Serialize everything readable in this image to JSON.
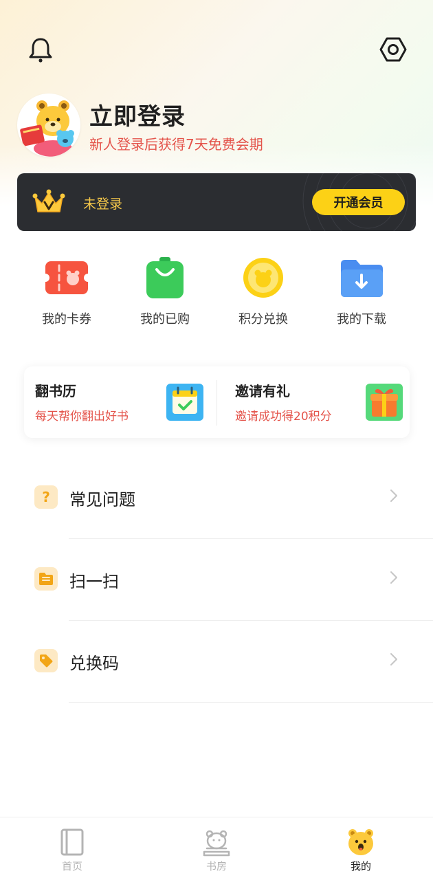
{
  "header": {
    "notification_icon": "bell-icon",
    "settings_icon": "hexagon-settings-icon"
  },
  "profile": {
    "avatar": "bear-mascot-avatar",
    "login_title": "立即登录",
    "login_subtitle": "新人登录后获得7天免费会期"
  },
  "vip": {
    "status": "未登录",
    "button_label": "开通会员",
    "accent_color": "#fcd116"
  },
  "quick_actions": [
    {
      "label": "我的卡券",
      "icon": "coupon-icon"
    },
    {
      "label": "我的已购",
      "icon": "shopping-bag-icon"
    },
    {
      "label": "积分兑换",
      "icon": "coin-icon"
    },
    {
      "label": "我的下载",
      "icon": "download-folder-icon"
    }
  ],
  "promos": [
    {
      "title": "翻书历",
      "subtitle": "每天帮你翻出好书",
      "icon": "calendar-icon"
    },
    {
      "title": "邀请有礼",
      "subtitle": "邀请成功得20积分",
      "icon": "gift-icon"
    }
  ],
  "menu": [
    {
      "label": "常见问题",
      "icon": "question-icon"
    },
    {
      "label": "扫一扫",
      "icon": "scan-icon"
    },
    {
      "label": "兑换码",
      "icon": "tag-icon"
    }
  ],
  "tabs": [
    {
      "label": "首页",
      "icon": "book-icon",
      "active": false
    },
    {
      "label": "书房",
      "icon": "study-room-icon",
      "active": false
    },
    {
      "label": "我的",
      "icon": "bear-face-icon",
      "active": true
    }
  ]
}
